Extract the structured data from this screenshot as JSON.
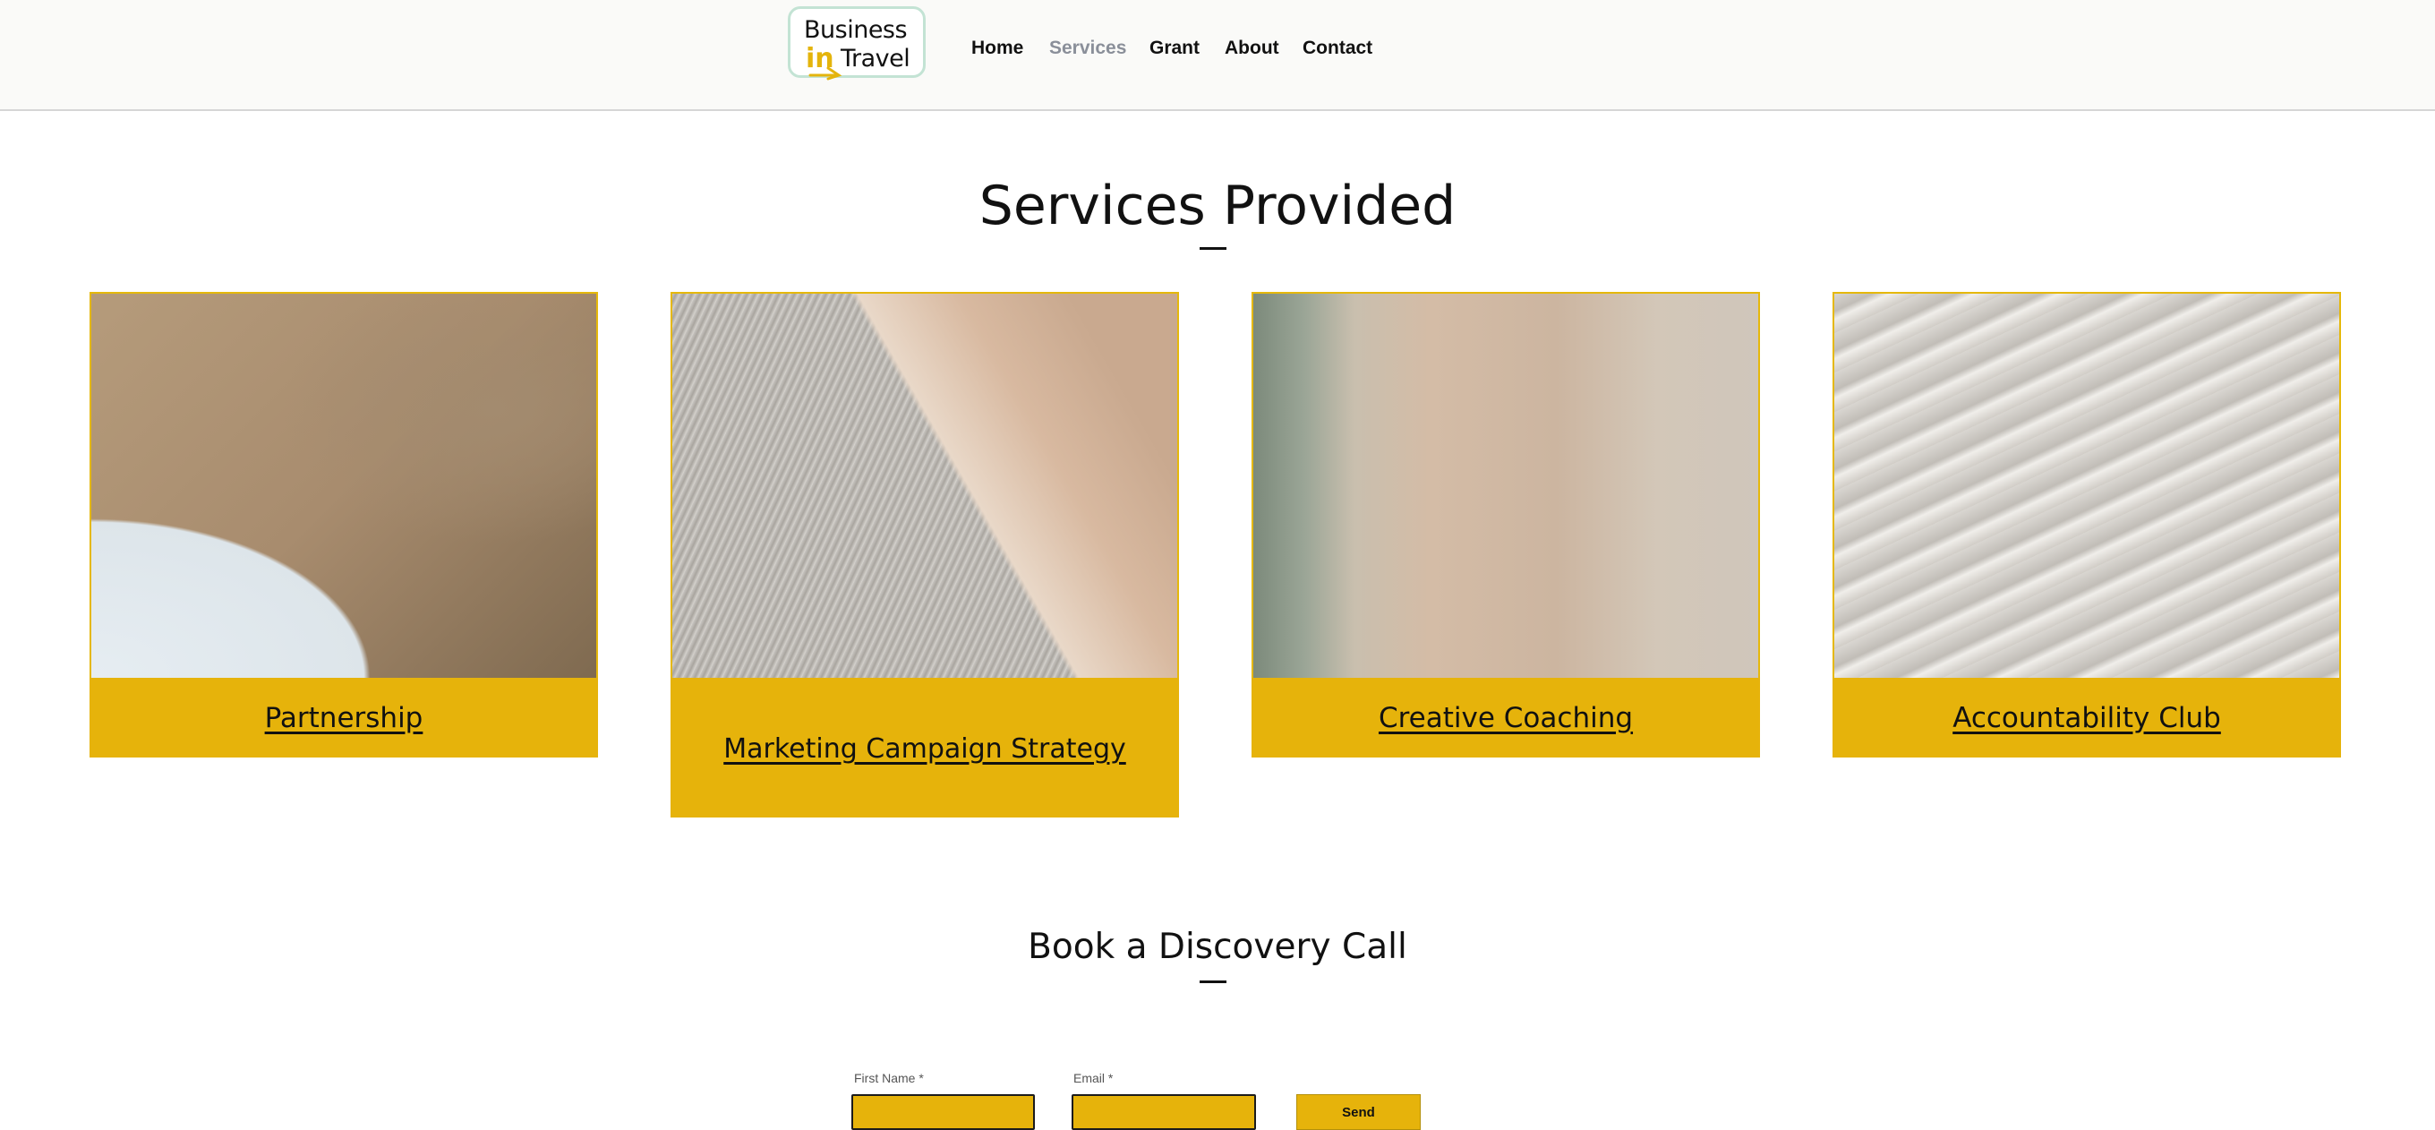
{
  "brand": {
    "line1": "Business",
    "in": "in",
    "line2": "Travel"
  },
  "nav": {
    "items": [
      {
        "label": "Home",
        "active": false
      },
      {
        "label": "Services",
        "active": true
      },
      {
        "label": "Grant",
        "active": false
      },
      {
        "label": "About",
        "active": false
      },
      {
        "label": "Contact",
        "active": false
      }
    ]
  },
  "services": {
    "title": "Services Provided",
    "cards": [
      {
        "label": "Partnership"
      },
      {
        "label": "Marketing Campaign Strategy"
      },
      {
        "label": "Creative Coaching"
      },
      {
        "label": "Accountability Club"
      }
    ]
  },
  "booking": {
    "title": "Book a Discovery Call",
    "first_name_label": "First Name *",
    "email_label": "Email *",
    "first_name_value": "",
    "email_value": "",
    "send_label": "Send"
  },
  "colors": {
    "accent": "#e6b30b",
    "logo_border": "#c3e3d4",
    "nav_active": "#8a8f99"
  }
}
